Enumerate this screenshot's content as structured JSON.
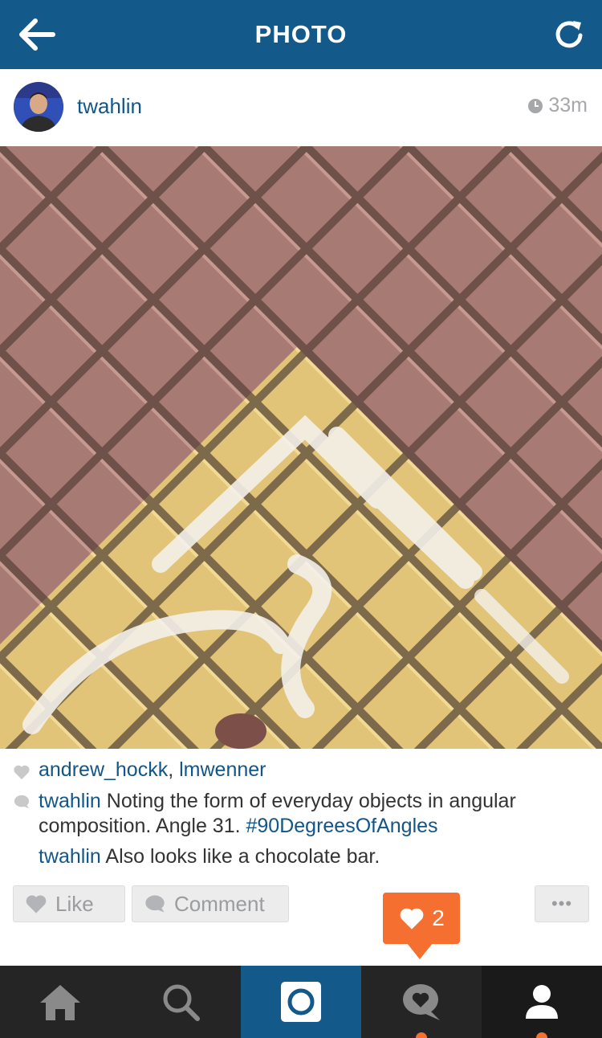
{
  "topbar": {
    "title": "PHOTO",
    "back_icon": "arrow-left-icon",
    "refresh_icon": "refresh-icon"
  },
  "post": {
    "username": "twahlin",
    "time": "33m",
    "likes_users": [
      "andrew_hockk",
      "lmwenner"
    ],
    "likes_separator": ", ",
    "comments": [
      {
        "user": "twahlin",
        "text": "Noting the form of everyday objects in angular composition. Angle 31. ",
        "hashtag": "#90DegreesOfAngles"
      },
      {
        "user": "twahlin",
        "text": "Also looks like a chocolate bar."
      }
    ]
  },
  "actions": {
    "like_label": "Like",
    "comment_label": "Comment",
    "more_label": "•••"
  },
  "notification": {
    "count": "2"
  },
  "tabs": [
    "home-icon",
    "search-icon",
    "camera-icon",
    "activity-icon",
    "profile-icon"
  ],
  "colors": {
    "brand": "#135989",
    "accent": "#f46f30",
    "link": "#125688"
  }
}
